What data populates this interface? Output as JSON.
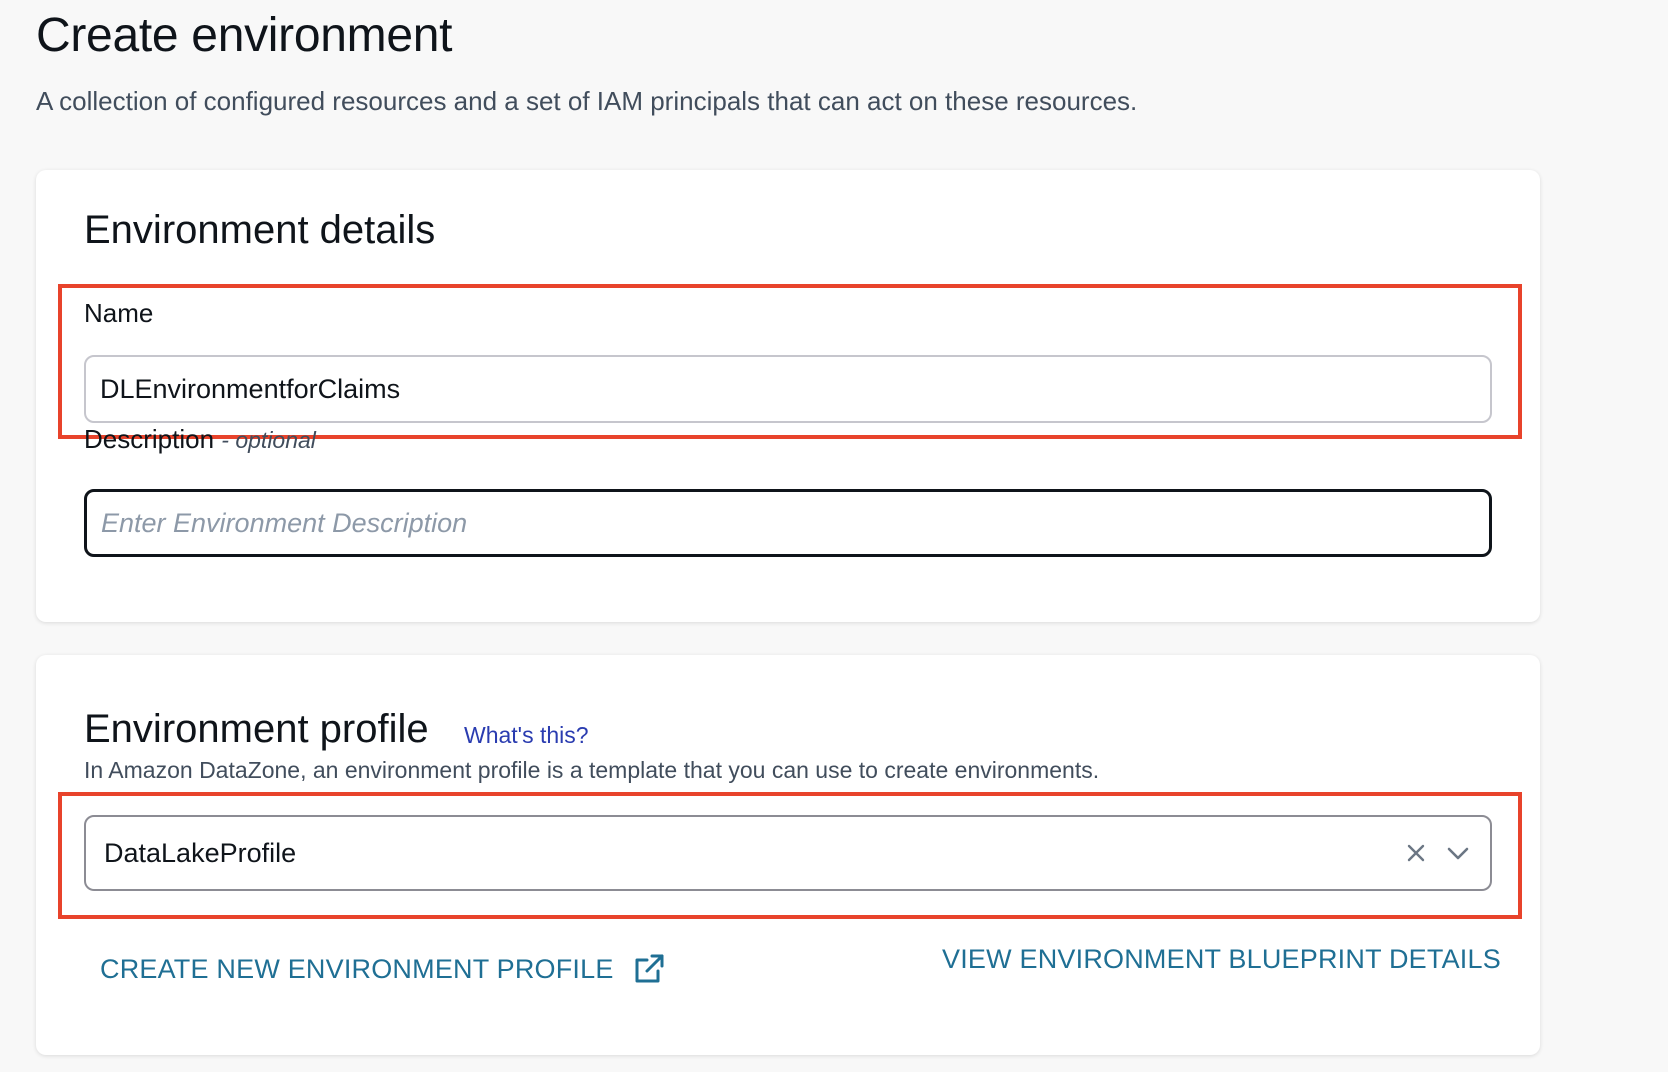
{
  "page": {
    "title": "Create environment",
    "subtitle": "A collection of configured resources and a set of IAM principals that can act on these resources."
  },
  "details": {
    "heading": "Environment details",
    "name_label": "Name",
    "name_value": "DLEnvironmentforClaims",
    "description_label": "Description",
    "description_optional": "- optional",
    "description_placeholder": "Enter Environment Description"
  },
  "profile": {
    "heading": "Environment profile",
    "whats_this": "What's this?",
    "description": "In Amazon DataZone, an environment profile is a template that you can use to create environments.",
    "selected_value": "DataLakeProfile",
    "clear_icon": "close-icon",
    "dropdown_icon": "chevron-down-icon",
    "create_link": "CREATE NEW ENVIRONMENT PROFILE",
    "create_link_icon": "external-link-icon",
    "view_link": "VIEW ENVIRONMENT BLUEPRINT DETAILS"
  },
  "colors": {
    "highlight": "#e8432b",
    "link": "#1f6f94",
    "info_link": "#2a3cb0"
  }
}
